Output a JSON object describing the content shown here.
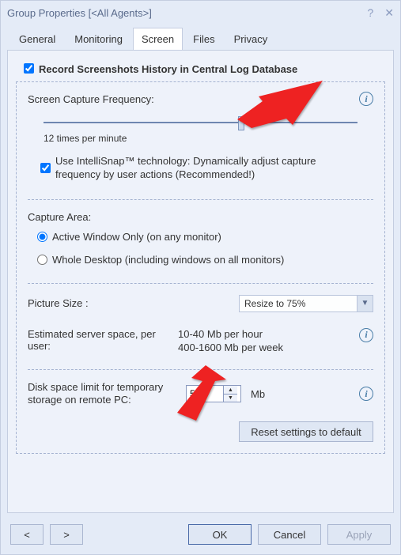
{
  "window": {
    "title": "Group Properties [<All Agents>]"
  },
  "tabs": {
    "general": "General",
    "monitoring": "Monitoring",
    "screen": "Screen",
    "files": "Files",
    "privacy": "Privacy"
  },
  "record": {
    "label": "Record Screenshots History in Central Log Database"
  },
  "freq": {
    "label": "Screen Capture Frequency:",
    "value_text": "12 times per minute",
    "intellisnap": "Use IntelliSnap™ technology: Dynamically adjust capture frequency by user actions (Recommended!)"
  },
  "area": {
    "label": "Capture Area:",
    "active": "Active Window Only (on any monitor)",
    "whole": "Whole Desktop (including windows on all monitors)"
  },
  "picture": {
    "label": "Picture Size :",
    "selected": "Resize to 75%"
  },
  "estimate": {
    "label": "Estimated server space, per user:",
    "hour": "10-40 Mb per hour",
    "week": "400-1600 Mb per week"
  },
  "disk": {
    "label": "Disk space limit for temporary storage on remote PC:",
    "value": "500",
    "unit": "Mb"
  },
  "buttons": {
    "reset": "Reset settings to default",
    "ok": "OK",
    "cancel": "Cancel",
    "apply": "Apply",
    "prev": "<",
    "next": ">"
  }
}
